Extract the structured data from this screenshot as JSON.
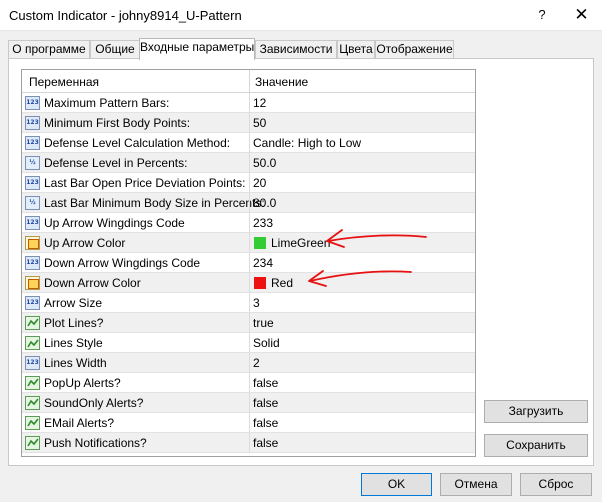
{
  "window": {
    "title": "Custom Indicator - johny8914_U-Pattern",
    "help_glyph": "?",
    "close_glyph": "✕"
  },
  "tabs": [
    {
      "label": "О программе"
    },
    {
      "label": "Общие"
    },
    {
      "label": "Входные параметры",
      "active": true
    },
    {
      "label": "Зависимости"
    },
    {
      "label": "Цвета"
    },
    {
      "label": "Отображение"
    }
  ],
  "grid": {
    "header_variable": "Переменная",
    "header_value": "Значение",
    "rows": [
      {
        "icon": "int-icon",
        "icon_text": "123",
        "name": "Maximum Pattern Bars:",
        "value": "12"
      },
      {
        "icon": "int-icon",
        "icon_text": "123",
        "name": "Minimum First Body Points:",
        "value": "50"
      },
      {
        "icon": "int-icon",
        "icon_text": "123",
        "name": "Defense Level Calculation Method:",
        "value": "Candle: High to Low"
      },
      {
        "icon": "double-icon",
        "icon_text": "½",
        "name": "Defense Level in Percents:",
        "value": "50.0"
      },
      {
        "icon": "int-icon",
        "icon_text": "123",
        "name": "Last Bar Open Price Deviation Points:",
        "value": "20"
      },
      {
        "icon": "double-icon",
        "icon_text": "½",
        "name": "Last Bar Minimum Body Size in Percents:",
        "value": "80.0"
      },
      {
        "icon": "int-icon",
        "icon_text": "123",
        "name": "Up Arrow Wingdings Code",
        "value": "233"
      },
      {
        "icon": "color-icon",
        "icon_text": "",
        "name": "Up Arrow Color",
        "value": "LimeGreen",
        "swatch": "#33cc33"
      },
      {
        "icon": "int-icon",
        "icon_text": "123",
        "name": "Down Arrow Wingdings Code",
        "value": "234"
      },
      {
        "icon": "color-icon",
        "icon_text": "",
        "name": "Down Arrow Color",
        "value": "Red",
        "swatch": "#ee1111"
      },
      {
        "icon": "int-icon",
        "icon_text": "123",
        "name": "Arrow Size",
        "value": "3"
      },
      {
        "icon": "bool-icon",
        "icon_text": "",
        "name": "Plot Lines?",
        "value": "true"
      },
      {
        "icon": "enum-icon",
        "icon_text": "",
        "name": "Lines Style",
        "value": "Solid"
      },
      {
        "icon": "int-icon",
        "icon_text": "123",
        "name": "Lines Width",
        "value": "2"
      },
      {
        "icon": "bool-icon",
        "icon_text": "",
        "name": "PopUp Alerts?",
        "value": "false"
      },
      {
        "icon": "bool-icon",
        "icon_text": "",
        "name": "SoundOnly Alerts?",
        "value": "false"
      },
      {
        "icon": "bool-icon",
        "icon_text": "",
        "name": "EMail Alerts?",
        "value": "false"
      },
      {
        "icon": "bool-icon",
        "icon_text": "",
        "name": "Push Notifications?",
        "value": "false"
      }
    ]
  },
  "side_buttons": {
    "load": "Загрузить",
    "save": "Сохранить"
  },
  "footer_buttons": {
    "ok": "OK",
    "cancel": "Отмена",
    "reset": "Сброс"
  },
  "colors": {
    "annotation_arrow": "#e81010",
    "grid_border": "#a0a0a0"
  }
}
